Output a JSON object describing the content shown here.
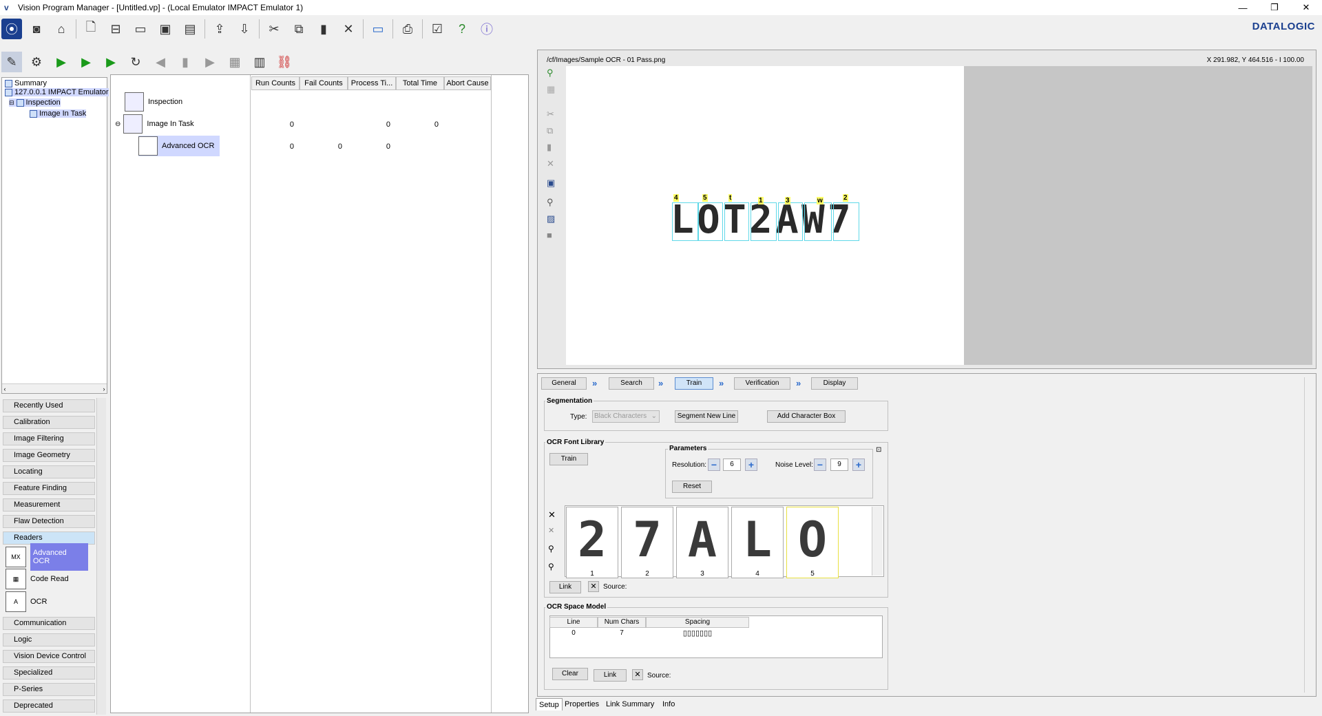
{
  "window": {
    "title": "Vision Program Manager - [Untitled.vp] - (Local Emulator IMPACT Emulator 1)",
    "minimize": "—",
    "maximize": "❐",
    "close": "✕"
  },
  "brand": {
    "logo": "DATALOGIC"
  },
  "tree": {
    "summary": "Summary",
    "device": "127.0.0.1 IMPACT Emulator",
    "inspection": "Inspection",
    "task": "Image In Task"
  },
  "categories": [
    "Recently Used",
    "Calibration",
    "Image Filtering",
    "Image Geometry",
    "Locating",
    "Feature Finding",
    "Measurement",
    "Flaw Detection",
    "Readers",
    "Communication",
    "Logic",
    "Vision Device Control",
    "Specialized",
    "P-Series",
    "Deprecated"
  ],
  "reader_tools": [
    {
      "label": "Advanced OCR",
      "icon": "MX"
    },
    {
      "label": "Code Read",
      "icon": "▦"
    },
    {
      "label": "OCR",
      "icon": "A"
    }
  ],
  "grid": {
    "headers": [
      "Run Counts",
      "Fail Counts",
      "Process Ti...",
      "Total Time",
      "Abort Cause"
    ],
    "rows": [
      {
        "name": "Inspection",
        "values": [
          "",
          "",
          "",
          "",
          ""
        ]
      },
      {
        "name": "Image In Task",
        "values": [
          "0",
          "",
          "0",
          "0",
          ""
        ]
      },
      {
        "name": "Advanced OCR",
        "values": [
          "0",
          "0",
          "0",
          "",
          ""
        ]
      }
    ]
  },
  "image": {
    "path": "/cf/Images/Sample OCR - 01 Pass.png",
    "coords": "X 291.982,  Y 464.516  -  I 100.00",
    "text": "LOT2AW7",
    "chars": [
      "L",
      "O",
      "T",
      "2",
      "A",
      "W",
      "7"
    ],
    "labels": [
      "4",
      "5",
      "t",
      "1",
      "3",
      "w",
      "2"
    ]
  },
  "steps": [
    "General",
    "Search",
    "Train",
    "Verification",
    "Display"
  ],
  "segmentation": {
    "title": "Segmentation",
    "type_label": "Type:",
    "type_value": "Black Characters",
    "segment_btn": "Segment New Line",
    "add_box_btn": "Add Character Box"
  },
  "font_library": {
    "title": "OCR Font Library",
    "train_btn": "Train",
    "params_title": "Parameters",
    "resolution_label": "Resolution:",
    "resolution_value": "6",
    "noise_label": "Noise Level:",
    "noise_value": "9",
    "reset_btn": "Reset",
    "thumbs": [
      {
        "glyph": "2",
        "n": "1"
      },
      {
        "glyph": "7",
        "n": "2"
      },
      {
        "glyph": "A",
        "n": "3"
      },
      {
        "glyph": "L",
        "n": "4"
      },
      {
        "glyph": "O",
        "n": "5"
      }
    ],
    "link_btn": "Link",
    "source_label": "Source:"
  },
  "space_model": {
    "title": "OCR Space Model",
    "headers": [
      "Line",
      "Num Chars",
      "Spacing"
    ],
    "row": [
      "0",
      "7",
      "▯▯▯▯▯▯▯"
    ],
    "clear_btn": "Clear",
    "link_btn": "Link",
    "source_label": "Source:"
  },
  "bottom_tabs": [
    "Setup",
    "Properties",
    "Link Summary",
    "Info"
  ]
}
